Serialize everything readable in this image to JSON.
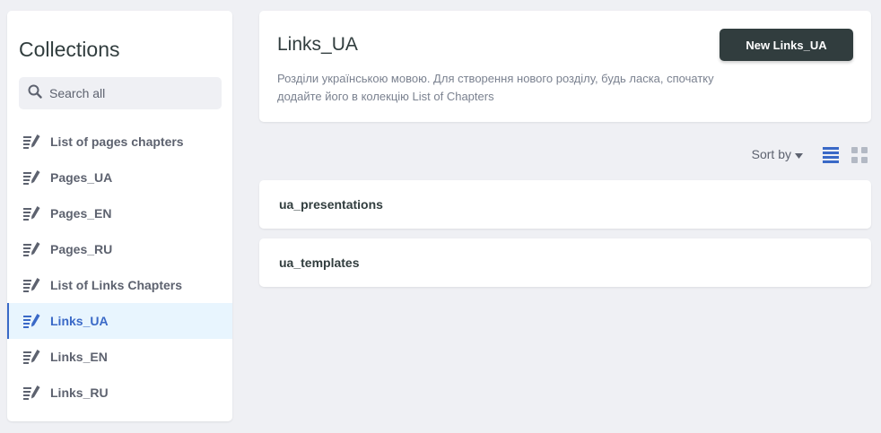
{
  "sidebar": {
    "title": "Collections",
    "search_placeholder": "Search all",
    "items": [
      {
        "label": "List of pages chapters",
        "icon": "edit-list-icon"
      },
      {
        "label": "Pages_UA",
        "icon": "edit-list-icon"
      },
      {
        "label": "Pages_EN",
        "icon": "edit-list-icon"
      },
      {
        "label": "Pages_RU",
        "icon": "edit-list-icon"
      },
      {
        "label": "List of Links Chapters",
        "icon": "edit-list-icon"
      },
      {
        "label": "Links_UA",
        "icon": "edit-list-icon",
        "active": true
      },
      {
        "label": "Links_EN",
        "icon": "edit-list-icon"
      },
      {
        "label": "Links_RU",
        "icon": "edit-list-icon"
      }
    ]
  },
  "header": {
    "title": "Links_UA",
    "description": "Розділи українською мовою. Для створення нового розділу, будь ласка, спочатку додайте його в колекцію List of Chapters",
    "new_button_label": "New Links_UA"
  },
  "toolbar": {
    "sort_label": "Sort by",
    "view_mode": "list"
  },
  "entries": [
    {
      "title": "ua_presentations"
    },
    {
      "title": "ua_templates"
    }
  ],
  "colors": {
    "background": "#eff0f4",
    "active_accent": "#3a69c7",
    "active_bg": "#e8f5fe",
    "button_dark": "#313d3e"
  }
}
